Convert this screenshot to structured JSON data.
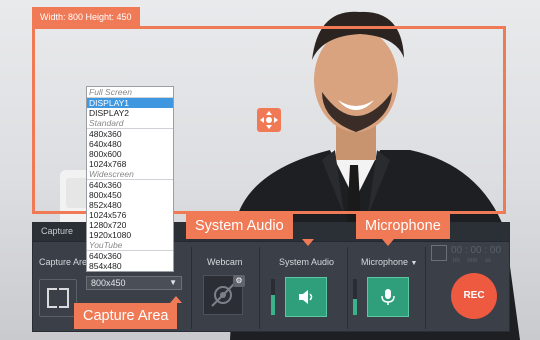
{
  "capture_size_label": "Width: 800  Height: 450",
  "panel": {
    "header_tab": "Capture",
    "capture_area_label": "Capture Are",
    "webcam_label": "Webcam",
    "system_audio_label": "System Audio",
    "microphone_label": "Microphone",
    "rec_label": "REC",
    "timer": "00 : 00 : 00",
    "timer_units": "hh mm ss"
  },
  "dropdown": {
    "selected_value": "800x450",
    "options": [
      {
        "kind": "group",
        "label": "Full Screen"
      },
      {
        "kind": "item",
        "label": "DISPLAY1",
        "selected": true
      },
      {
        "kind": "item",
        "label": "DISPLAY2"
      },
      {
        "kind": "group",
        "label": "Standard"
      },
      {
        "kind": "item",
        "label": "480x360"
      },
      {
        "kind": "item",
        "label": "640x480"
      },
      {
        "kind": "item",
        "label": "800x600"
      },
      {
        "kind": "item",
        "label": "1024x768"
      },
      {
        "kind": "group",
        "label": "Widescreen"
      },
      {
        "kind": "item",
        "label": "640x360"
      },
      {
        "kind": "item",
        "label": "800x450"
      },
      {
        "kind": "item",
        "label": "852x480"
      },
      {
        "kind": "item",
        "label": "1024x576"
      },
      {
        "kind": "item",
        "label": "1280x720"
      },
      {
        "kind": "item",
        "label": "1920x1080"
      },
      {
        "kind": "group",
        "label": "YouTube"
      },
      {
        "kind": "item",
        "label": "640x360"
      },
      {
        "kind": "item",
        "label": "854x480"
      }
    ]
  },
  "callouts": {
    "system_audio": "System Audio",
    "microphone": "Microphone",
    "capture_area": "Capture Area"
  },
  "levels": {
    "system_audio": 0.55,
    "microphone": 0.45
  },
  "colors": {
    "accent": "#f07a56",
    "panel_bg": "#3b4048",
    "toggle_green": "#2e9e7b",
    "rec_red": "#ee5a3f",
    "list_selected": "#3f97e0"
  },
  "icons": [
    "move-icon",
    "capture-area-icon",
    "webcam-off-icon",
    "gear-icon",
    "speaker-icon",
    "microphone-icon",
    "clock-icon",
    "chevron-down-icon"
  ]
}
